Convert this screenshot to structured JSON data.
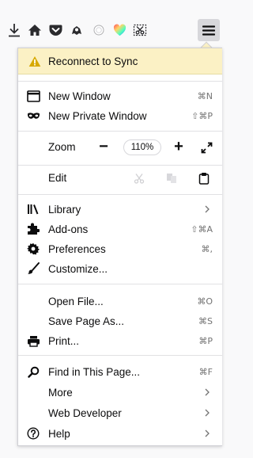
{
  "banner": {
    "label": "Reconnect to Sync"
  },
  "items": {
    "new_window": {
      "label": "New Window",
      "shortcut": "⌘N"
    },
    "new_private_window": {
      "label": "New Private Window",
      "shortcut": "⇧⌘P"
    },
    "zoom": {
      "label": "Zoom",
      "minus": "−",
      "value": "110%",
      "plus": "+"
    },
    "edit": {
      "label": "Edit"
    },
    "library": {
      "label": "Library"
    },
    "addons": {
      "label": "Add-ons",
      "shortcut": "⇧⌘A"
    },
    "preferences": {
      "label": "Preferences",
      "shortcut": "⌘,"
    },
    "customize": {
      "label": "Customize..."
    },
    "open_file": {
      "label": "Open File...",
      "shortcut": "⌘O"
    },
    "save_page": {
      "label": "Save Page As...",
      "shortcut": "⌘S"
    },
    "print": {
      "label": "Print...",
      "shortcut": "⌘P"
    },
    "find": {
      "label": "Find in This Page...",
      "shortcut": "⌘F"
    },
    "more": {
      "label": "More"
    },
    "web_developer": {
      "label": "Web Developer"
    },
    "help": {
      "label": "Help"
    }
  },
  "toolbar_icons": [
    "download-icon",
    "home-icon",
    "pocket-icon",
    "extension-icon",
    "circle-icon",
    "heart-icon",
    "screenshot-icon",
    "hamburger-menu-icon"
  ],
  "colors": {
    "banner_bg": "#fbf1c5",
    "warning": "#d7a900",
    "heart_gradient": [
      "#ff4f5e",
      "#ffd567",
      "#54ffbd",
      "#0a84ff"
    ]
  }
}
